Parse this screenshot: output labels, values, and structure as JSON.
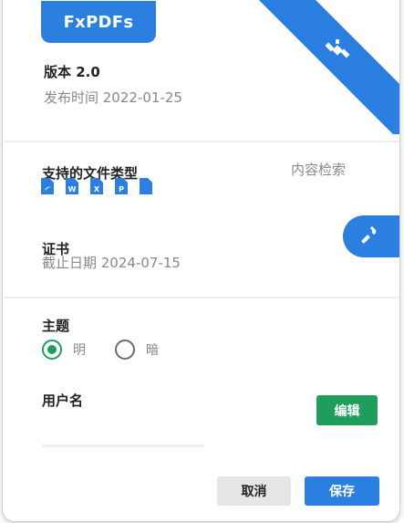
{
  "brand": {
    "name": "FxPDFs",
    "accent_color": "#2a7fe0"
  },
  "ribbon": {
    "icon": "satellite-icon"
  },
  "version": {
    "title": "版本 2.0",
    "release_date": "发布时间 2022-01-25"
  },
  "file_types": {
    "title": "支持的文件类型",
    "items": [
      {
        "icon": "pdf-file-icon",
        "glyph": ""
      },
      {
        "icon": "word-file-icon",
        "glyph": "W"
      },
      {
        "icon": "excel-file-icon",
        "glyph": "X"
      },
      {
        "icon": "powerpoint-file-icon",
        "glyph": "P"
      },
      {
        "icon": "generic-file-icon",
        "glyph": ""
      }
    ],
    "content_search_label": "内容检索"
  },
  "certificate": {
    "title": "证书",
    "expiry": "截止日期 2024-07-15",
    "action_icon": "hammer-icon"
  },
  "theme": {
    "title": "主题",
    "options": [
      {
        "label": "明",
        "selected": true
      },
      {
        "label": "暗",
        "selected": false
      }
    ],
    "selected_color": "#1e9e5a"
  },
  "username": {
    "title": "用户名",
    "value": "",
    "edit_label": "编辑",
    "edit_color": "#1e9e5a"
  },
  "footer": {
    "cancel_label": "取消",
    "save_label": "保存"
  }
}
